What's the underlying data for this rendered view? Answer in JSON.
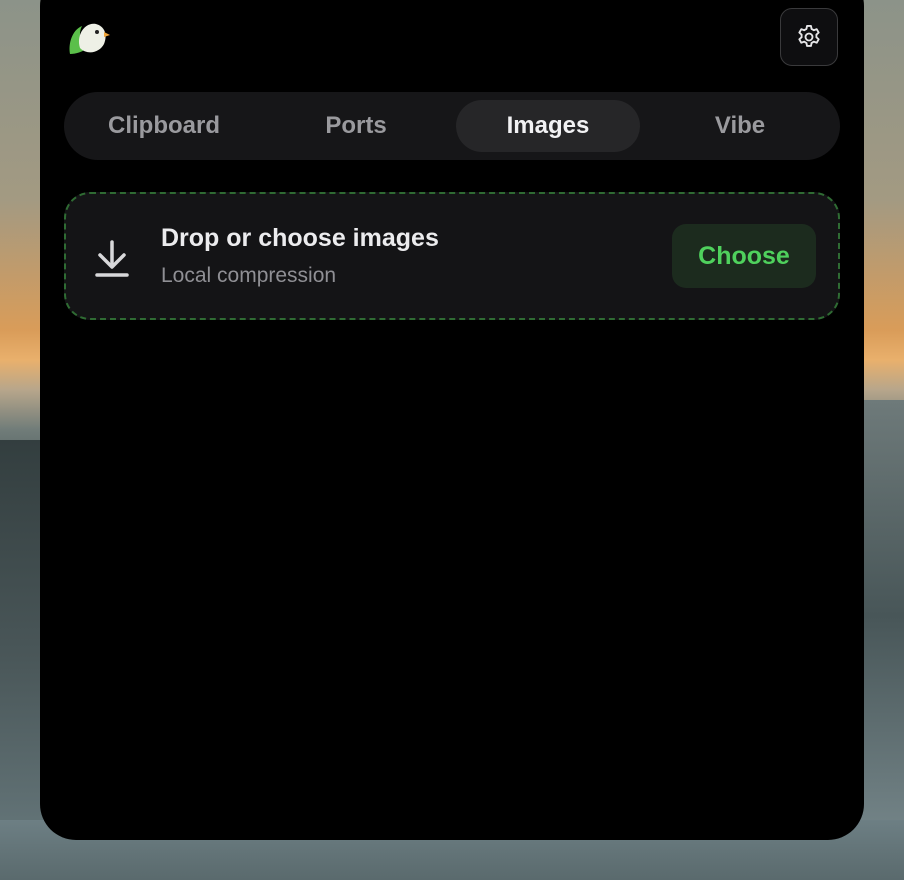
{
  "header": {
    "logo_icon": "bird-logo-icon",
    "settings_icon": "gear-icon"
  },
  "tabs": [
    {
      "label": "Clipboard",
      "active": false
    },
    {
      "label": "Ports",
      "active": false
    },
    {
      "label": "Images",
      "active": true
    },
    {
      "label": "Vibe",
      "active": false
    }
  ],
  "dropzone": {
    "icon": "download-arrow-icon",
    "title": "Drop or choose images",
    "subtitle": "Local compression",
    "button_label": "Choose"
  },
  "colors": {
    "accent_green": "#4fd15d",
    "panel_bg": "#000000",
    "dashed_border": "#2f6b33"
  }
}
